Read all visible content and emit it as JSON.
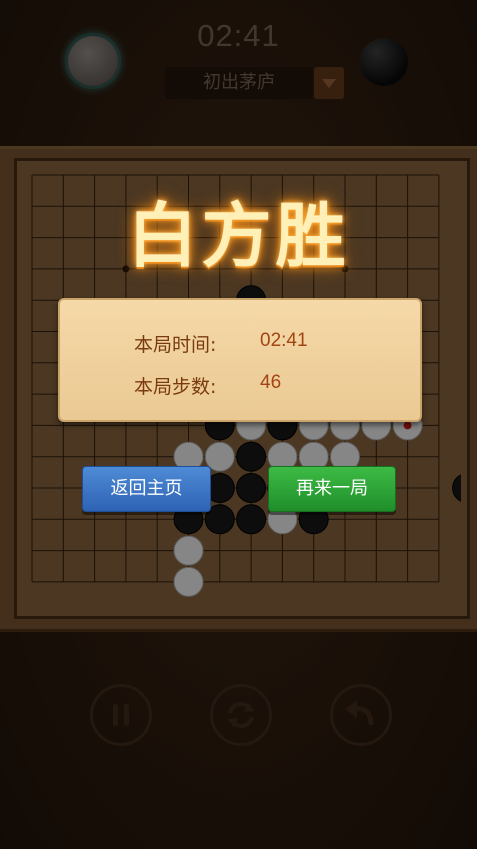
{
  "header": {
    "timer": "02:41",
    "level": "初出茅庐",
    "player_white": "white-stone-avatar",
    "player_black": "black-stone-avatar"
  },
  "result": {
    "title": "白方胜",
    "time_label": "本局时间:",
    "time_value": "02:41",
    "moves_label": "本局步数:",
    "moves_value": "46"
  },
  "buttons": {
    "home": "返回主页",
    "again": "再来一局"
  },
  "controls": {
    "pause": "pause-icon",
    "restart": "restart-icon",
    "undo": "undo-icon"
  },
  "colors": {
    "home_button": "#3a77c8",
    "again_button": "#2ca236",
    "title_glow": "#ff9a1f"
  }
}
